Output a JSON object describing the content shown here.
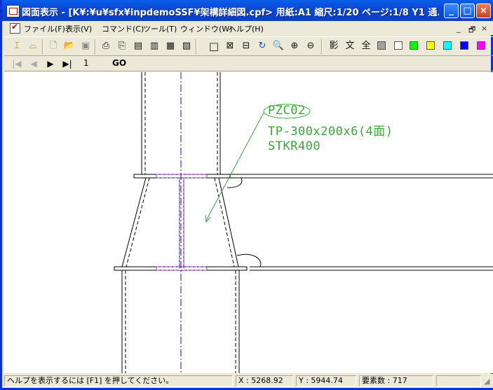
{
  "window": {
    "title": "図面表示 - [K¥:¥u¥sfx¥inpdemoSSF¥架構詳細図.cpf> 用紙:A1 縮尺:1/20 ページ:1/8 Y1 通..."
  },
  "menu": {
    "items": [
      "ファイル(F)",
      "表示(V)",
      "コマンド(C)",
      "ツール(T)",
      "ウィンドウ(W)",
      "ヘルプ(H)"
    ],
    "mdi_minimize": "_",
    "mdi_restore": "🗗",
    "mdi_close": "×"
  },
  "toolbar": {
    "text_buttons": [
      "影",
      "文",
      "全"
    ],
    "colors": [
      "#a0a0a0",
      "#ffffff",
      "#00ff00",
      "#ffff00",
      "#00ffff",
      "#0000ff",
      "#ff00ff"
    ]
  },
  "navigation": {
    "first": "|◀",
    "prev": "◀",
    "next": "▶",
    "last": "▶|",
    "page": "1",
    "go_label": "GO"
  },
  "drawing": {
    "member_name": "PZC02",
    "section": "TP-300x200x6(4面)",
    "material": "STKR400",
    "line_color": "#3aa63a",
    "accent_color": "#9933cc",
    "centerline_color": "#1010d0"
  },
  "status": {
    "help": "ヘルプを表示するには [F1] を押してください。",
    "x": "X : 5268.92",
    "y": "Y : 5944.74",
    "count": "要素数 : 717"
  }
}
